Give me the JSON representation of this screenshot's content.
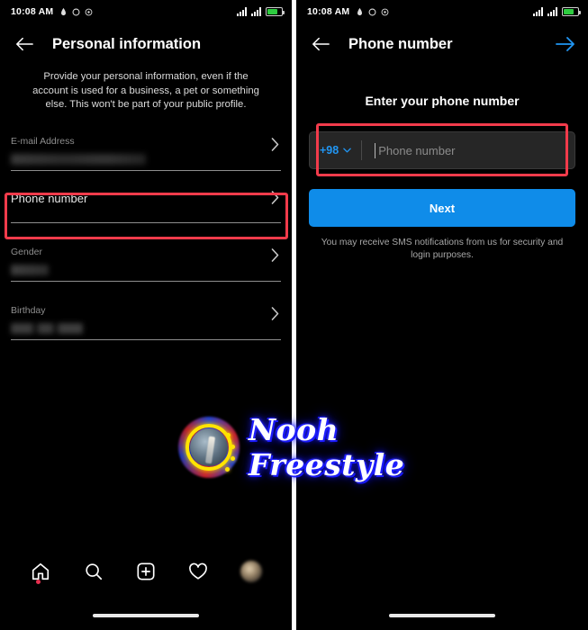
{
  "status_bar": {
    "time": "10:08 AM",
    "icons": [
      "alarm-icon",
      "circle-icon",
      "location-icon"
    ],
    "right_icons": [
      "signal-bars-icon",
      "signal-bars-icon",
      "battery-icon"
    ]
  },
  "left_panel": {
    "app_bar": {
      "back_icon": "back-arrow-icon",
      "title": "Personal information"
    },
    "description": "Provide your personal information, even if the account is used for a business, a pet or something else. This won't be part of your public profile.",
    "fields": [
      {
        "label": "E-mail Address",
        "value": "",
        "redacted": true,
        "chevron": "chevron-right-icon"
      },
      {
        "label": "Phone number",
        "value": "",
        "redacted": false,
        "chevron": "chevron-right-icon",
        "highlighted": true
      },
      {
        "label": "Gender",
        "value": "",
        "redacted": true,
        "chevron": "chevron-right-icon"
      },
      {
        "label": "Birthday",
        "value": "",
        "redacted": true,
        "chevron": "chevron-right-icon"
      }
    ],
    "bottom_nav": [
      {
        "name": "home-icon",
        "badge": true
      },
      {
        "name": "search-icon",
        "badge": false
      },
      {
        "name": "add-post-icon",
        "badge": false
      },
      {
        "name": "heart-icon",
        "badge": false
      },
      {
        "name": "profile-avatar",
        "badge": false
      }
    ]
  },
  "right_panel": {
    "app_bar": {
      "back_icon": "back-arrow-icon",
      "title": "Phone number",
      "forward_icon": "forward-arrow-icon"
    },
    "heading": "Enter your phone number",
    "phone_input": {
      "country_code": "+98",
      "dropdown_icon": "chevron-down-icon",
      "placeholder": "Phone number",
      "value": "",
      "highlighted": true
    },
    "next_button": "Next",
    "sms_note": "You may receive SMS notifications from us for security and login purposes."
  },
  "watermark": {
    "text": "Nooh Freestyle",
    "logo": "nooh-freestyle-logo"
  },
  "colors": {
    "accent_blue": "#0f8ce9",
    "link_blue": "#2196f3",
    "highlight_red": "#f23b4b",
    "background": "#000000",
    "input_bg": "#262626",
    "muted_text": "#8e8e8e"
  }
}
